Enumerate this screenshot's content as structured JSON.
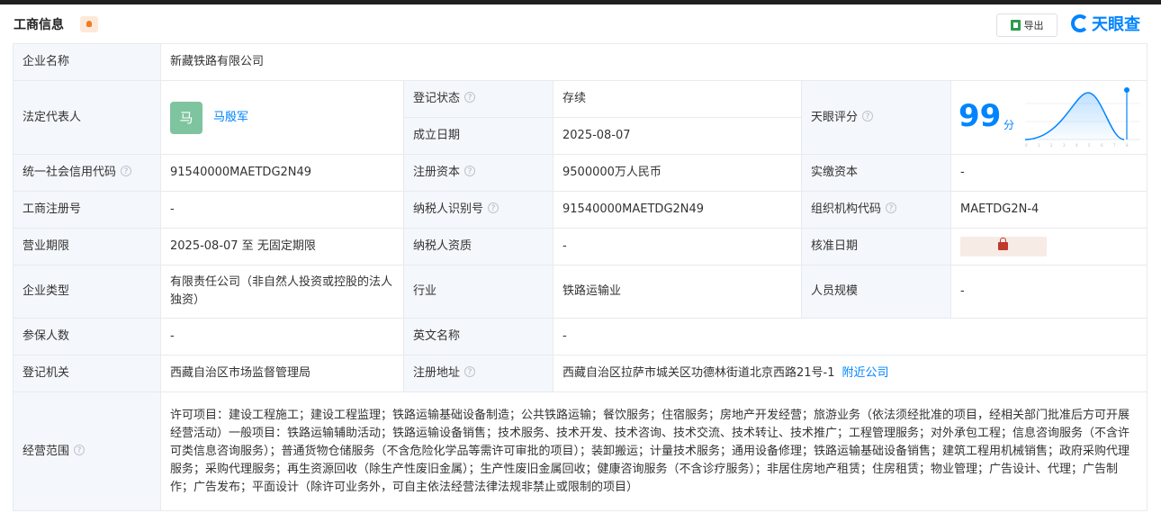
{
  "header": {
    "title": "工商信息",
    "export_label": "导出",
    "brand": "天眼查"
  },
  "company_name": {
    "label": "企业名称",
    "value": "新藏铁路有限公司"
  },
  "legal_rep": {
    "label": "法定代表人",
    "avatar_char": "马",
    "name": "马殷军"
  },
  "reg_status": {
    "label": "登记状态",
    "value": "存续"
  },
  "founded": {
    "label": "成立日期",
    "value": "2025-08-07"
  },
  "tianyan_score": {
    "label": "天眼评分",
    "value": "99",
    "unit": "分"
  },
  "credit_code": {
    "label": "统一社会信用代码",
    "value": "91540000MAETDG2N49"
  },
  "reg_capital": {
    "label": "注册资本",
    "value": "9500000万人民币"
  },
  "paid_capital": {
    "label": "实缴资本",
    "value": "-"
  },
  "biz_reg_no": {
    "label": "工商注册号",
    "value": "-"
  },
  "taxpayer_id": {
    "label": "纳税人识别号",
    "value": "91540000MAETDG2N49"
  },
  "org_code": {
    "label": "组织机构代码",
    "value": "MAETDG2N-4"
  },
  "biz_term": {
    "label": "营业期限",
    "value": "2025-08-07 至 无固定期限"
  },
  "taxpayer_qual": {
    "label": "纳税人资质",
    "value": "-"
  },
  "approval_date": {
    "label": "核准日期"
  },
  "company_type": {
    "label": "企业类型",
    "value": "有限责任公司（非自然人投资或控股的法人独资）"
  },
  "industry": {
    "label": "行业",
    "value": "铁路运输业"
  },
  "staff_size": {
    "label": "人员规模",
    "value": "-"
  },
  "insured": {
    "label": "参保人数",
    "value": "-"
  },
  "english_name": {
    "label": "英文名称",
    "value": "-"
  },
  "reg_authority": {
    "label": "登记机关",
    "value": "西藏自治区市场监督管理局"
  },
  "reg_address": {
    "label": "注册地址",
    "value": "西藏自治区拉萨市城关区功德林街道北京西路21号-1",
    "link": "附近公司"
  },
  "business_scope": {
    "label": "经营范围",
    "value": "许可项目：建设工程施工；建设工程监理；铁路运输基础设备制造；公共铁路运输；餐饮服务；住宿服务；房地产开发经营；旅游业务（依法须经批准的项目，经相关部门批准后方可开展经营活动）一般项目：铁路运输辅助活动；铁路运输设备销售；技术服务、技术开发、技术咨询、技术交流、技术转让、技术推广；工程管理服务；对外承包工程；信息咨询服务（不含许可类信息咨询服务）；普通货物仓储服务（不含危险化学品等需许可审批的项目）；装卸搬运；计量技术服务；通用设备修理；铁路运输基础设备销售；建筑工程用机械销售；政府采购代理服务；采购代理服务；再生资源回收（除生产性废旧金属）；生产性废旧金属回收；健康咨询服务（不含诊疗服务）；非居住房地产租赁；住房租赁；物业管理；广告设计、代理；广告制作；广告发布；平面设计（除许可业务外，可自主依法经营法律法规非禁止或限制的项目）"
  },
  "colors": {
    "accent": "#0084ff",
    "status_green": "#14a34d",
    "label_bg": "#f4f7fb",
    "border": "#e8eaef"
  }
}
